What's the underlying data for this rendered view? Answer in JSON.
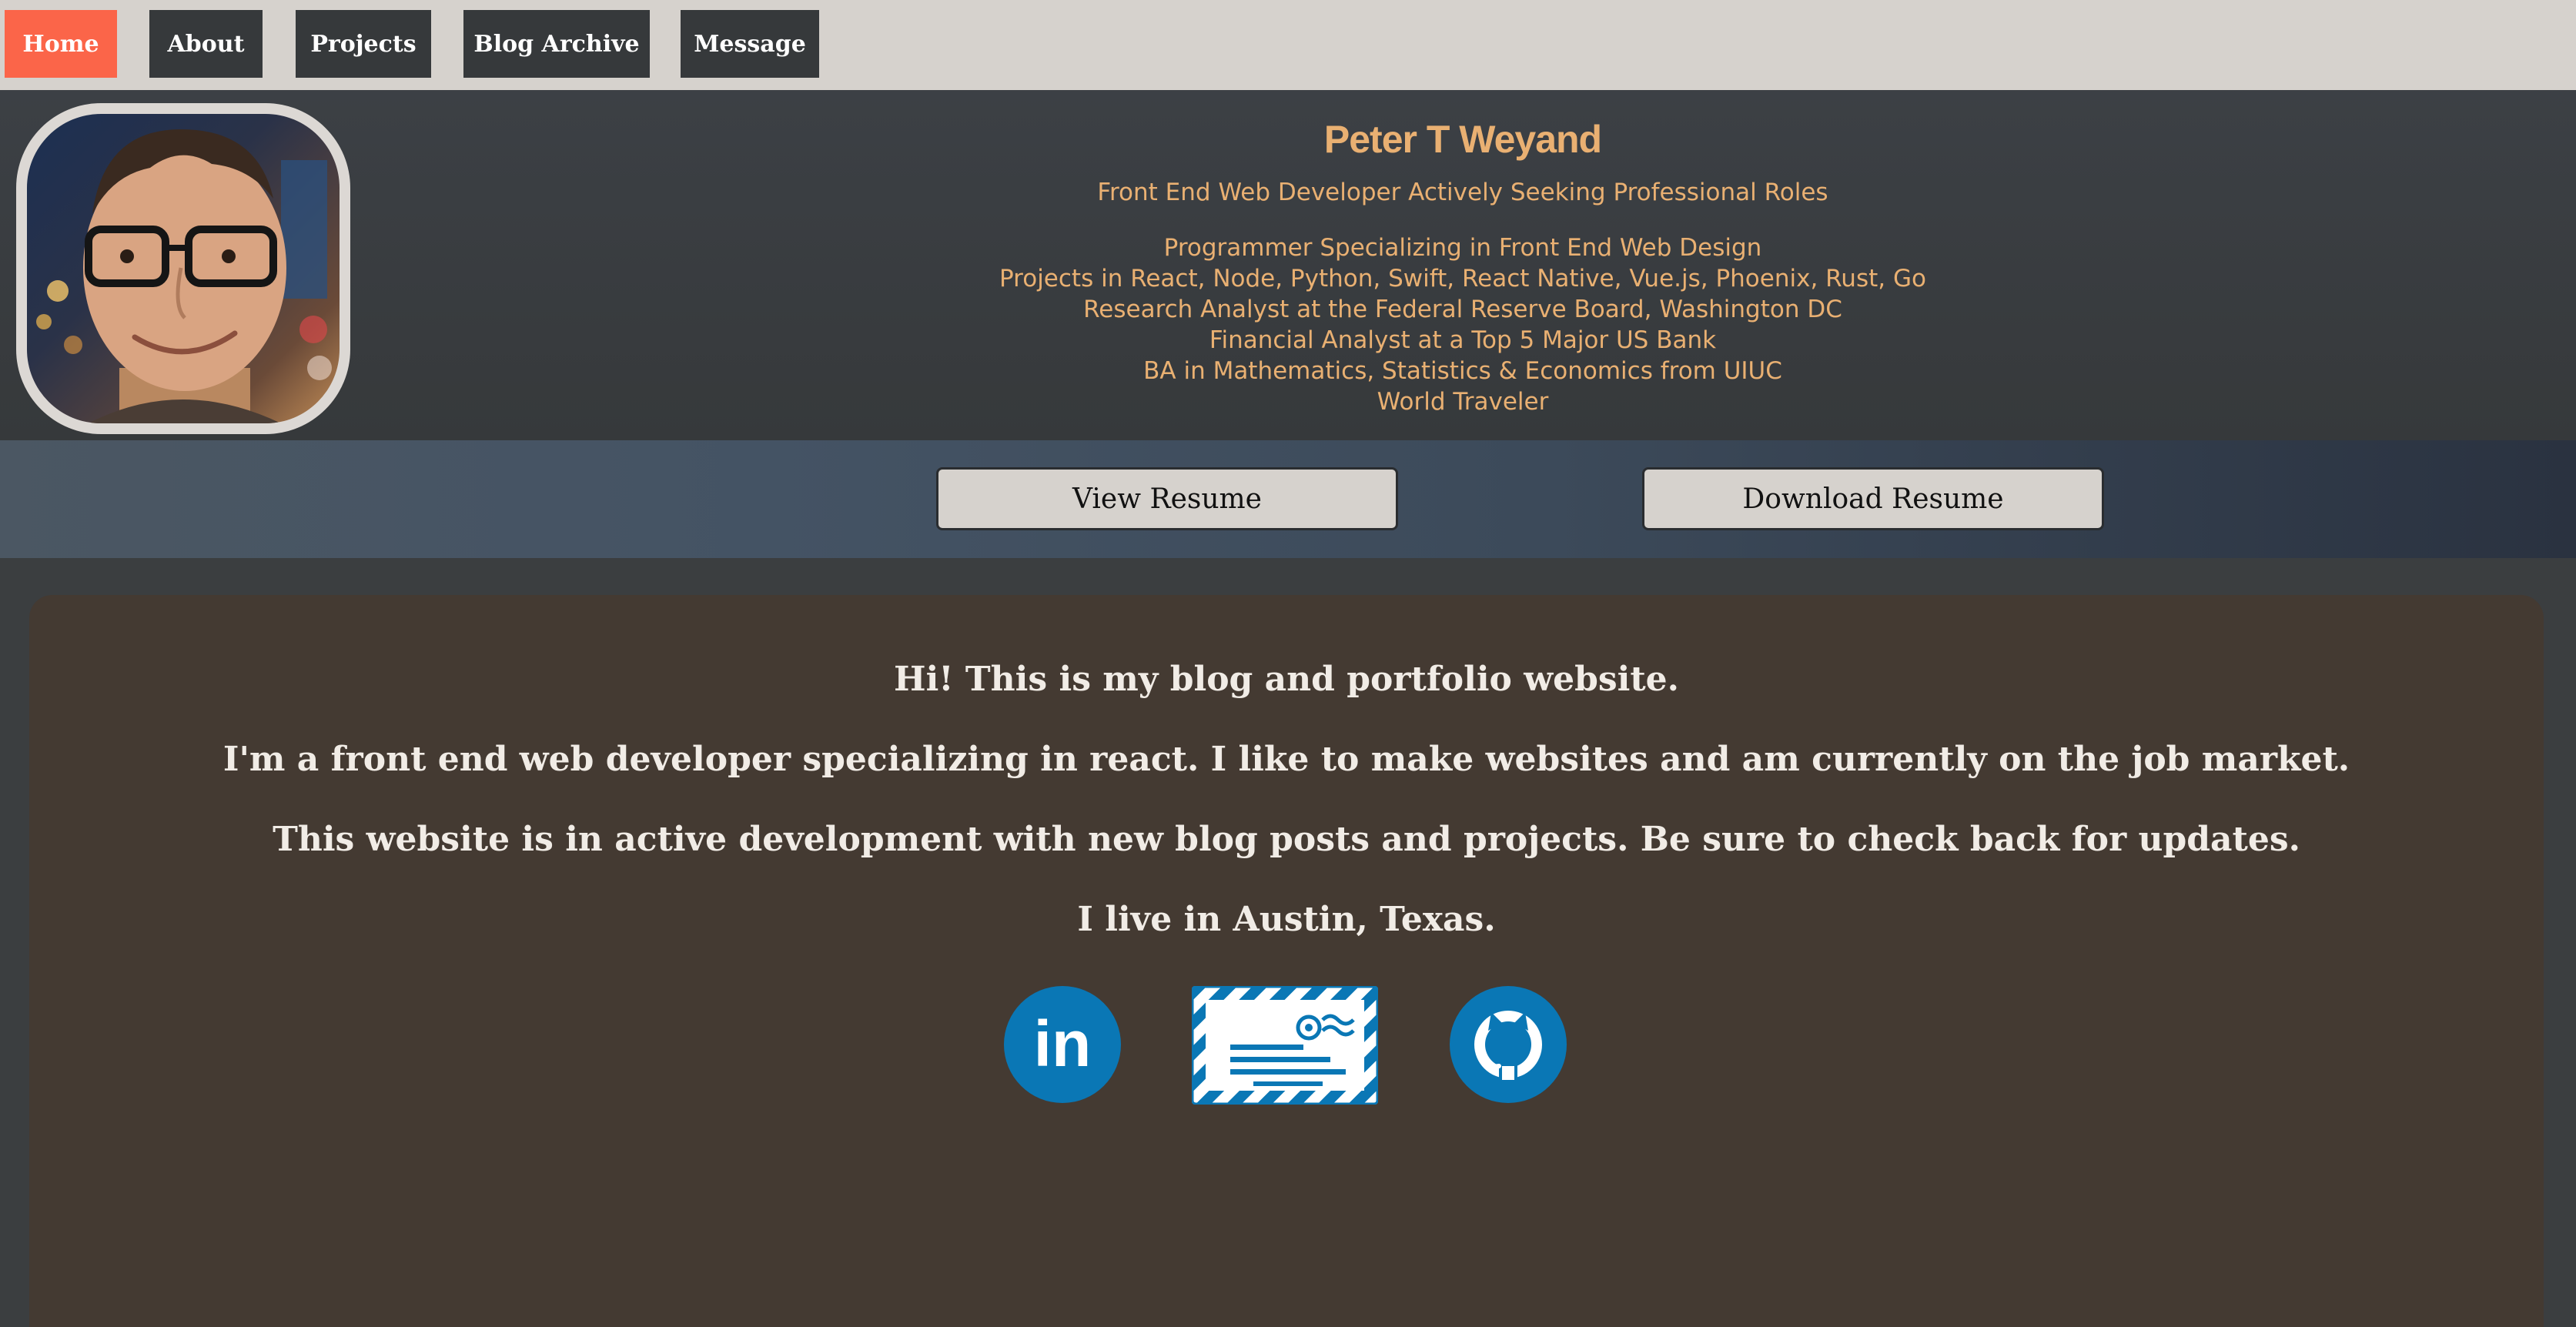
{
  "nav": {
    "items": [
      {
        "label": "Home",
        "active": true
      },
      {
        "label": "About",
        "active": false
      },
      {
        "label": "Projects",
        "active": false
      },
      {
        "label": "Blog Archive",
        "active": false
      },
      {
        "label": "Message",
        "active": false
      }
    ]
  },
  "header": {
    "name": "Peter T Weyand",
    "subtitle": "Front End Web Developer Actively Seeking Professional Roles",
    "lines": [
      "Programmer Specializing in Front End Web Design",
      "Projects in React, Node, Python, Swift, React Native, Vue.js, Phoenix, Rust, Go",
      "Research Analyst at the Federal Reserve Board, Washington DC",
      "Financial Analyst at a Top 5 Major US Bank",
      "BA in Mathematics, Statistics & Economics from UIUC",
      "World Traveler"
    ]
  },
  "resume": {
    "view_label": "View Resume",
    "download_label": "Download Resume"
  },
  "intro": {
    "lines": [
      "Hi! This is my blog and portfolio website.",
      "I'm a front end web developer specializing in react. I like to make websites and am currently on the job market.",
      "This website is in active development with new blog posts and projects. Be sure to check back for updates.",
      "I live in Austin, Texas."
    ]
  },
  "social": {
    "icons": [
      "linkedin-icon",
      "mail-icon",
      "github-icon"
    ],
    "linkedin_text": "in"
  },
  "colors": {
    "nav_bg": "#d6d2cd",
    "nav_btn": "#36393b",
    "nav_active": "#fb6549",
    "accent_text": "#e9b072",
    "card_bg": "#443a32",
    "social_blue": "#0a77b5"
  }
}
